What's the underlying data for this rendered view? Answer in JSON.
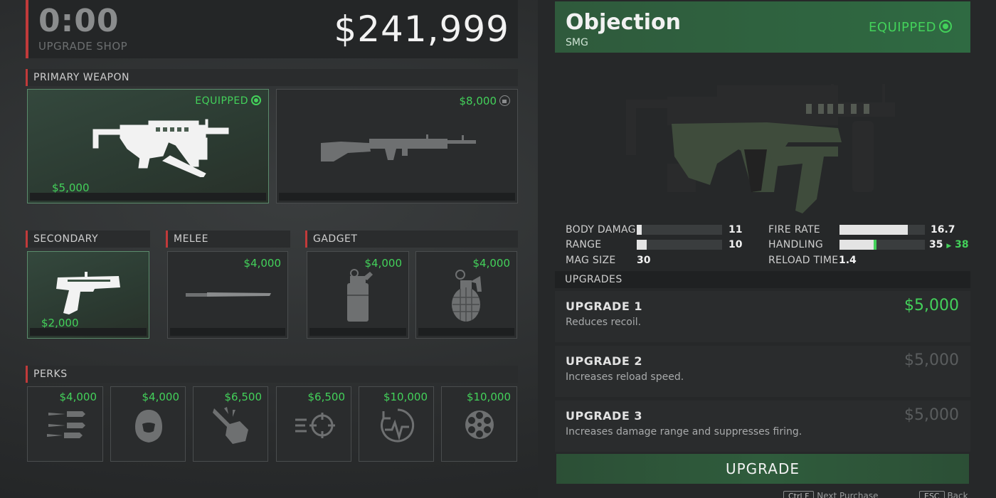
{
  "header": {
    "timer": "0:00",
    "shop_label": "UPGRADE SHOP",
    "money": "$241,999"
  },
  "primary": {
    "label": "PRIMARY WEAPON",
    "items": [
      {
        "name": "Objection",
        "price": "$5,000",
        "equipped_text": "EQUIPPED",
        "icon": "smg-icon",
        "equipped": true
      },
      {
        "name": "rifle",
        "price": "$8,000",
        "icon": "rifle-icon",
        "locked": true
      }
    ]
  },
  "secondary": {
    "label": "SECONDARY",
    "items": [
      {
        "price": "$2,000",
        "icon": "pistol-icon",
        "equipped": true
      }
    ]
  },
  "melee": {
    "label": "MELEE",
    "items": [
      {
        "price": "$4,000",
        "icon": "machete-icon"
      }
    ]
  },
  "gadget": {
    "label": "GADGET",
    "items": [
      {
        "price": "$4,000",
        "icon": "smoke-grenade-icon"
      },
      {
        "price": "$4,000",
        "icon": "frag-grenade-icon"
      }
    ]
  },
  "perks": {
    "label": "PERKS",
    "items": [
      {
        "price": "$4,000",
        "icon": "speed-bullets-icon"
      },
      {
        "price": "$4,000",
        "icon": "hooded-figure-icon"
      },
      {
        "price": "$6,500",
        "icon": "strong-arm-icon"
      },
      {
        "price": "$6,500",
        "icon": "fast-crosshair-icon"
      },
      {
        "price": "$10,000",
        "icon": "heartbeat-timer-icon"
      },
      {
        "price": "$10,000",
        "icon": "revolver-cylinder-icon"
      }
    ]
  },
  "detail": {
    "title": "Objection",
    "subtitle": "SMG",
    "equipped_text": "EQUIPPED",
    "stats": {
      "body_damage": {
        "label": "BODY DAMAGE",
        "value": "11",
        "level": 0.06
      },
      "range": {
        "label": "RANGE",
        "value": "10",
        "level": 0.12
      },
      "mag_size": {
        "label": "MAG SIZE",
        "value": "30"
      },
      "fire_rate": {
        "label": "FIRE RATE",
        "value": "16.7",
        "level": 0.8
      },
      "handling": {
        "label": "HANDLING",
        "value": "35",
        "upgraded_value": "38",
        "level": 0.4,
        "upgraded_level": 0.43
      },
      "reload_time": {
        "label": "RELOAD TIME",
        "value": "1.4"
      }
    },
    "upgrades_label": "UPGRADES",
    "upgrades": [
      {
        "title": "UPGRADE 1",
        "desc": "Reduces recoil.",
        "price": "$5,000",
        "affordable": true
      },
      {
        "title": "UPGRADE 2",
        "desc": "Increases reload speed.",
        "price": "$5,000",
        "affordable": false
      },
      {
        "title": "UPGRADE 3",
        "desc": "Increases damage range and suppresses firing.",
        "price": "$5,000",
        "affordable": false
      }
    ],
    "upgrade_button": "UPGRADE",
    "hints": [
      {
        "key": "Ctrl F",
        "label": "Next Purchase"
      },
      {
        "key": "ESC",
        "label": "Back"
      }
    ]
  },
  "colors": {
    "accent_green": "#43d15a",
    "accent_red": "#c13a3a",
    "panel": "#2a2c2d"
  }
}
